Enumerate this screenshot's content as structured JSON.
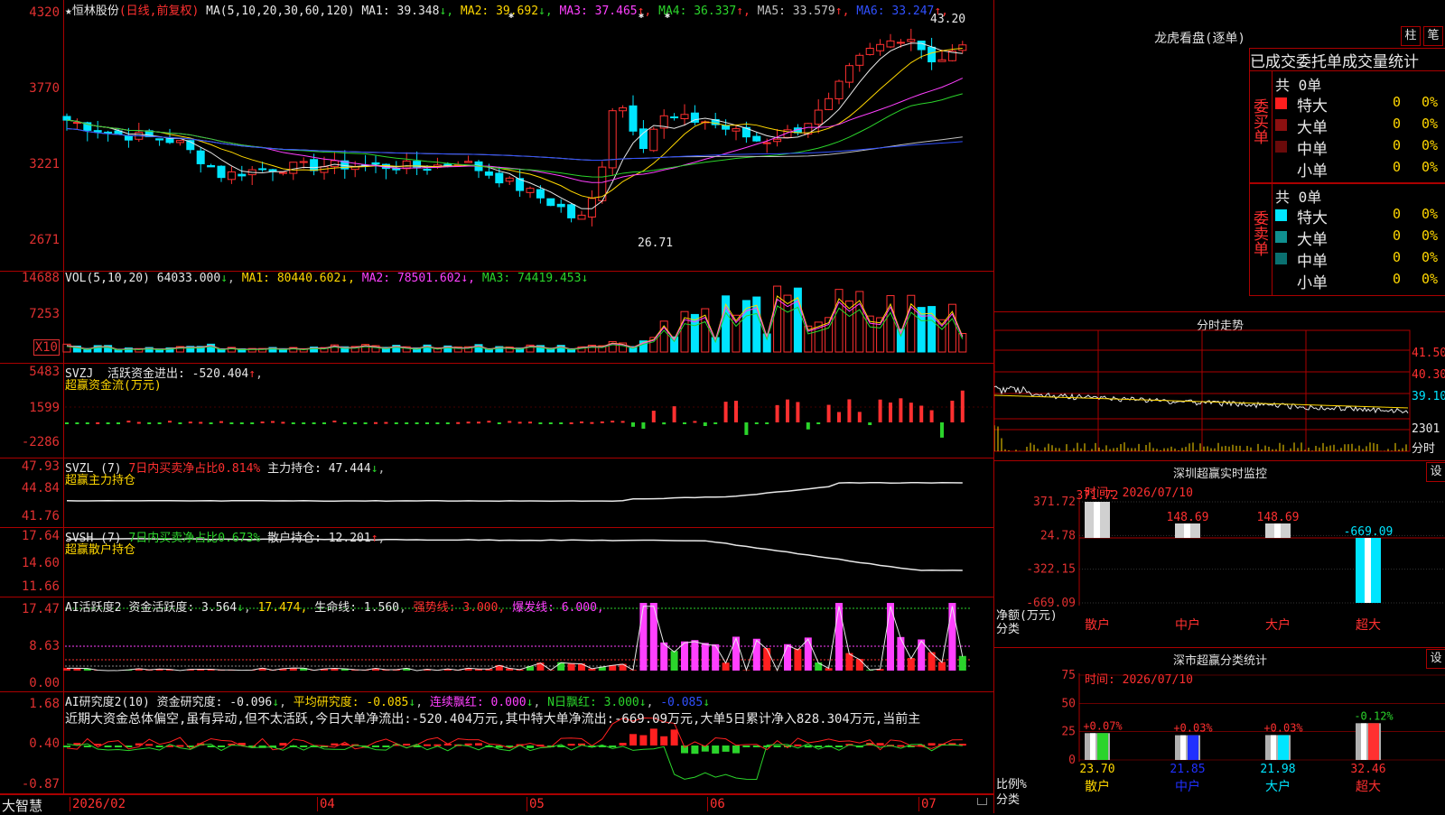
{
  "main": {
    "stock_name": "恒林股份",
    "period": "(日线,前复权)",
    "ma_params": "MA(5,10,20,30,60,120)",
    "ma": [
      {
        "label": "MA1:",
        "value": "39.348",
        "arrow": "↓",
        "color": "#e8e8e8"
      },
      {
        "label": "MA2:",
        "value": "39.692",
        "arrow": "↓",
        "color": "#ffd700"
      },
      {
        "label": "MA3:",
        "value": "37.465",
        "arrow": "↑",
        "color": "#ff40ff"
      },
      {
        "label": "MA4:",
        "value": "36.337",
        "arrow": "↑",
        "color": "#2bd42b"
      },
      {
        "label": "MA5:",
        "value": "33.579",
        "arrow": "↑",
        "color": "#c0c0c0"
      },
      {
        "label": "MA6:",
        "value": "33.247",
        "arrow": "↑",
        "color": "#3050ff"
      }
    ],
    "yticks": [
      "4320",
      "3770",
      "3221",
      "2671"
    ],
    "high_label": "43.20",
    "low_label": "26.71"
  },
  "vol": {
    "title": "VOL(5,10,20)",
    "value": "64033.000",
    "ma1": "80440.602",
    "ma2": "78501.602",
    "ma3": "74419.453",
    "yticks": [
      "14688",
      "7253"
    ],
    "unit": "X10"
  },
  "svzj": {
    "title": "SVZJ",
    "label": "活跃资金进出:",
    "value": "-520.404",
    "subtitle": "超赢资金流(万元)",
    "yticks": [
      "5483",
      "1599",
      "-2286"
    ]
  },
  "svzl": {
    "title": "SVZL (7)",
    "ratio_label": "7日内买卖净占比0.814%",
    "hold_label": "主力持仓:",
    "hold_value": "47.444",
    "subtitle": "超赢主力持仓",
    "yticks": [
      "47.93",
      "44.84",
      "41.76"
    ]
  },
  "svsh": {
    "title": "SVSH (7)",
    "ratio_label": "7日内买卖净占比0.673%",
    "hold_label": "散户持仓:",
    "hold_value": "12.201",
    "subtitle": "超赢散户持仓",
    "yticks": [
      "17.64",
      "14.60",
      "11.66"
    ]
  },
  "ai1": {
    "title": "AI活跃度2",
    "label": "资金活跃度:",
    "value": "3.564",
    "value2": "17.474",
    "life_label": "生命线:",
    "life_value": "1.560",
    "strong": "强势线: 3.000",
    "burst": "爆发线: 6.000",
    "yticks": [
      "17.47",
      "8.63",
      "0.00"
    ]
  },
  "ai2": {
    "title": "AI研究度2(10)",
    "label": "资金研究度:",
    "value": "-0.096",
    "avg_label": "平均研究度:",
    "avg_value": "-0.085",
    "red_label": "连续飘红:",
    "red_value": "0.000",
    "nred_label": "N日飘红:",
    "nred_value": "3.000",
    "last": "-0.085",
    "comment": "近期大资金总体偏空,虽有异动,但不太活跃,今日大单净流出:-520.404万元,其中特大单净流出:-669.09万元,大单5日累计净入828.304万元,当前主",
    "yticks": [
      "1.68",
      "0.40",
      "-0.87"
    ]
  },
  "bottom": {
    "brand": "大智慧",
    "dates": [
      "2026/02",
      "04",
      "05",
      "06",
      "07"
    ]
  },
  "dragon": {
    "title": "龙虎看盘(逐单)",
    "btn_bar": "柱",
    "btn_pen": "笔",
    "tabs": [
      "已成交",
      "委托单",
      "成交量统计"
    ],
    "buy": {
      "label": "委买单",
      "count": "共 0单",
      "rows": [
        {
          "name": "特大",
          "value": "0",
          "pct": "0%",
          "color": "#ff1e1e"
        },
        {
          "name": "大单",
          "value": "0",
          "pct": "0%",
          "color": "#8b1010"
        },
        {
          "name": "中单",
          "value": "0",
          "pct": "0%",
          "color": "#6a0a0a"
        },
        {
          "name": "小单",
          "value": "0",
          "pct": "0%",
          "color": ""
        }
      ]
    },
    "sell": {
      "label": "委卖单",
      "count": "共 0单",
      "rows": [
        {
          "name": "特大",
          "value": "0",
          "pct": "0%",
          "color": "#00e5ff"
        },
        {
          "name": "大单",
          "value": "0",
          "pct": "0%",
          "color": "#109090"
        },
        {
          "name": "中单",
          "value": "0",
          "pct": "0%",
          "color": "#0a7070"
        },
        {
          "name": "小单",
          "value": "0",
          "pct": "0%",
          "color": ""
        }
      ]
    }
  },
  "intraday": {
    "title": "分时走势",
    "yticks": [
      "41.50",
      "40.30",
      "39.10",
      "2301"
    ],
    "foot": "分时"
  },
  "monitor": {
    "title": "深圳超赢实时监控",
    "btn": "设",
    "time": "时间: 2026/07/10",
    "yticks": [
      "371.72",
      "24.78",
      "-322.15",
      "-669.09"
    ],
    "ylabel": "净额(万元)",
    "xlabel": "分类",
    "bars": [
      {
        "cat": "散户",
        "value": "371.72",
        "num": 371.72
      },
      {
        "cat": "中户",
        "value": "148.69",
        "num": 148.69
      },
      {
        "cat": "大户",
        "value": "148.69",
        "num": 148.69
      },
      {
        "cat": "超大",
        "value": "-669.09",
        "num": -669.09
      }
    ]
  },
  "classify": {
    "title": "深市超赢分类统计",
    "btn": "设",
    "time": "时间: 2026/07/10",
    "yticks": [
      "75",
      "50",
      "25",
      "0"
    ],
    "ylabel": "比例%",
    "xlabel": "分类",
    "bars": [
      {
        "cat": "散户",
        "top": "+0.07%",
        "pct": "23.70",
        "num": 23.7,
        "color": "#2bd42b"
      },
      {
        "cat": "中户",
        "top": "+0.03%",
        "pct": "21.85",
        "num": 21.85,
        "color": "#2030ff"
      },
      {
        "cat": "大户",
        "top": "+0.03%",
        "pct": "21.98",
        "num": 21.98,
        "color": "#00e5ff"
      },
      {
        "cat": "超大",
        "top": "-0.12%",
        "pct": "32.46",
        "num": 32.46,
        "color": "#ff3030"
      }
    ]
  }
}
